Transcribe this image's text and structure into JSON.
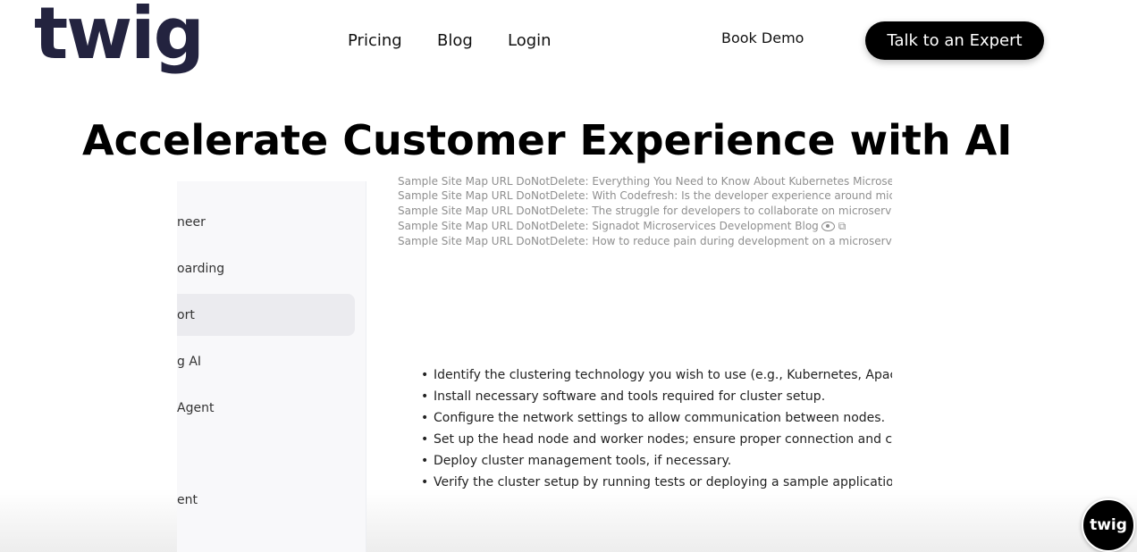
{
  "header": {
    "logo": "twig",
    "nav": [
      "Pricing",
      "Blog",
      "Login"
    ],
    "book_demo": "Book Demo",
    "cta": "Talk to an Expert"
  },
  "hero": {
    "headline": "Accelerate Customer Experience with AI"
  },
  "app": {
    "sidebar_items": [
      "neer",
      "oarding",
      "ort",
      "g AI",
      "Agent",
      "ent"
    ],
    "sidebar_active_index": 2,
    "sitemap_lines": [
      "Sample Site Map URL DoNotDelete: Everything You Need to Know About Kubernetes Microservices",
      "Sample Site Map URL DoNotDelete: With Codefresh: Is the developer experience around microservices",
      "Sample Site Map URL DoNotDelete: The struggle for developers to collaborate on microservices",
      "Sample Site Map URL DoNotDelete: Signadot Microservices Development Blog",
      "Sample Site Map URL DoNotDelete: How to reduce pain during development on a microservice architecture"
    ],
    "steps": [
      "Identify the clustering technology you wish to use (e.g., Kubernetes, Apache Hadoop).",
      "Install necessary software and tools required for cluster setup.",
      "Configure the network settings to allow communication between nodes.",
      "Set up the head node and worker nodes; ensure proper connection and communication.",
      "Deploy cluster management tools, if necessary.",
      "Verify the cluster setup by running tests or deploying a sample application."
    ]
  },
  "badge": "twig",
  "colors": {
    "logo": "#23233f",
    "cta_bg": "#000000"
  }
}
